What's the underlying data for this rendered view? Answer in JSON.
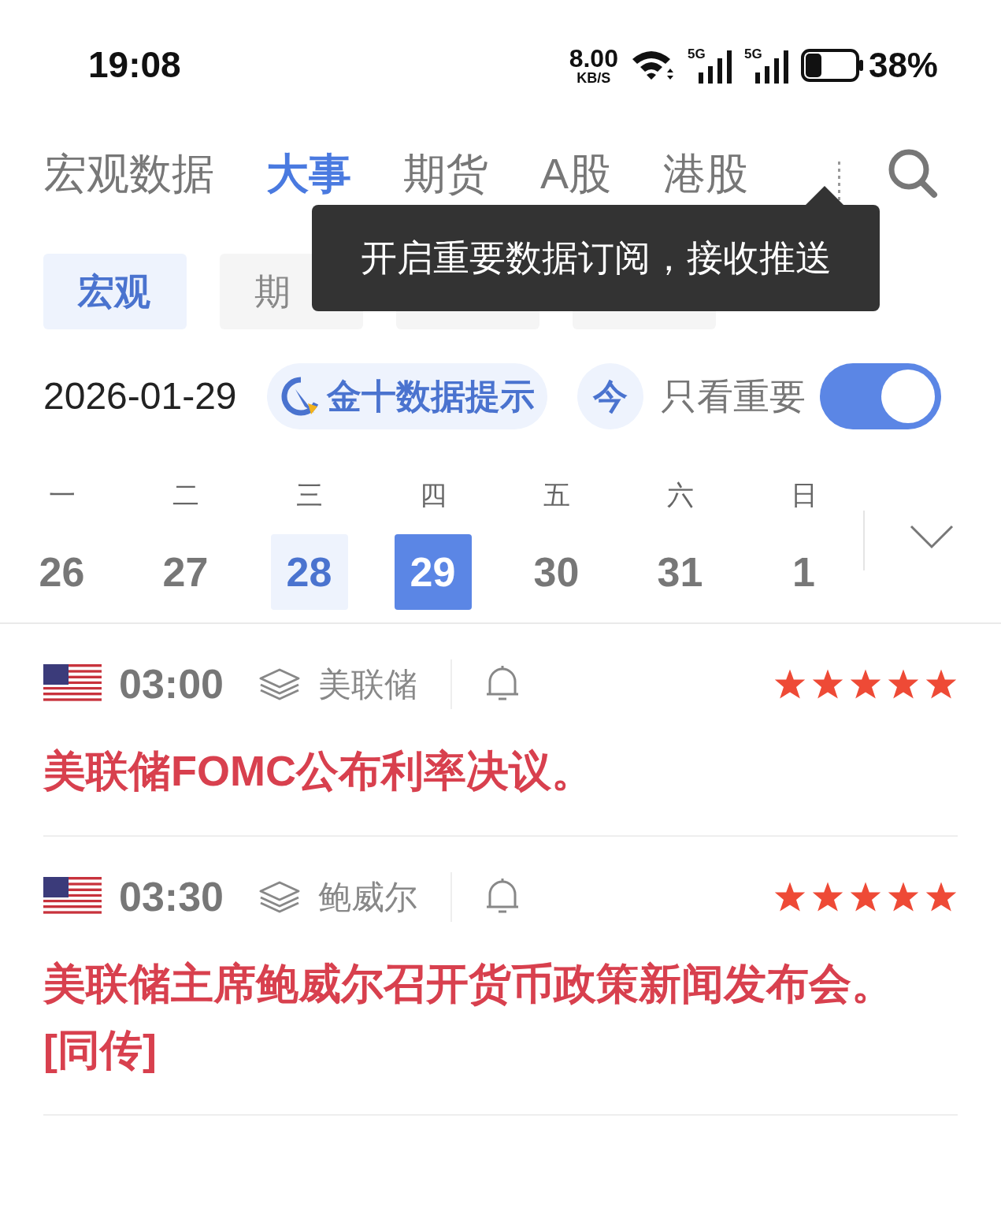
{
  "status_bar": {
    "time": "19:08",
    "speed_value": "8.00",
    "speed_unit": "KB/S",
    "network_1": "5G",
    "network_2": "5G",
    "battery": "38%"
  },
  "tabs": [
    {
      "label": "宏观数据",
      "selected": false
    },
    {
      "label": "大事",
      "selected": true
    },
    {
      "label": "期货",
      "selected": false
    },
    {
      "label": "A股",
      "selected": false
    },
    {
      "label": "港股",
      "selected": false
    }
  ],
  "tooltip": {
    "text": "开启重要数据订阅，接收推送"
  },
  "sub_tabs": [
    {
      "label": "宏观",
      "selected": true
    },
    {
      "label": "期",
      "selected": false
    }
  ],
  "date": "2026-01-29",
  "tip_button": "金十数据提示",
  "today_button": "今",
  "important_only": {
    "label": "只看重要",
    "on": true
  },
  "weekdays": [
    "一",
    "二",
    "三",
    "四",
    "五",
    "六",
    "日"
  ],
  "days": [
    {
      "label": "26",
      "selected": false,
      "highlighted": false
    },
    {
      "label": "27",
      "selected": false,
      "highlighted": false
    },
    {
      "label": "28",
      "selected": false,
      "highlighted": true
    },
    {
      "label": "29",
      "selected": true,
      "highlighted": false
    },
    {
      "label": "30",
      "selected": false,
      "highlighted": false
    },
    {
      "label": "31",
      "selected": false,
      "highlighted": false
    },
    {
      "label": "1",
      "selected": false,
      "highlighted": false
    }
  ],
  "events": [
    {
      "time": "03:00",
      "source": "美联储",
      "stars": 5,
      "title": "美联储FOMC公布利率决议。"
    },
    {
      "time": "03:30",
      "source": "鲍威尔",
      "stars": 5,
      "title": "美联储主席鲍威尔召开货币政策新闻发布会。[同传]"
    }
  ]
}
